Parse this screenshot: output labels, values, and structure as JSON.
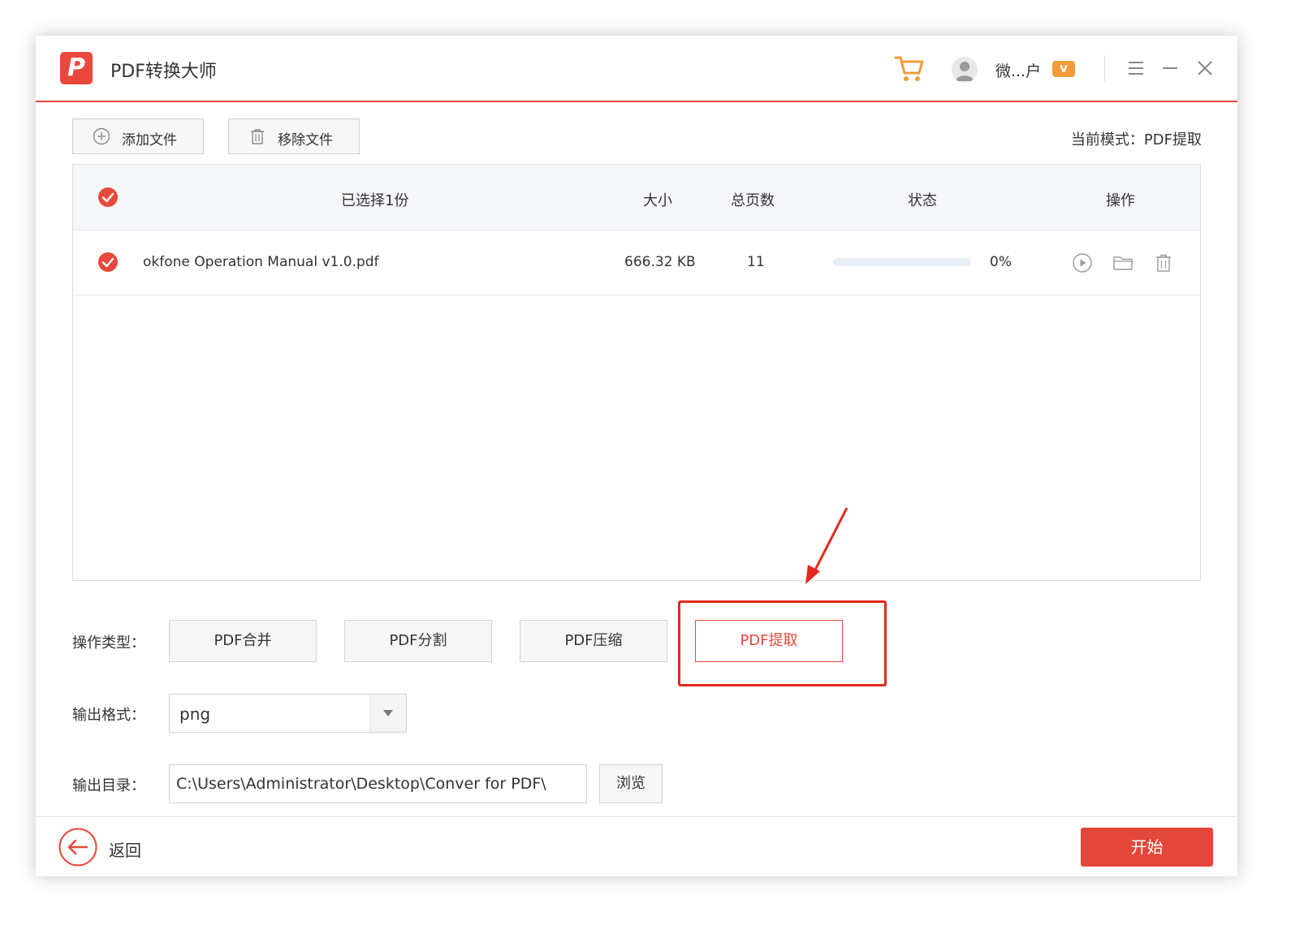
{
  "app": {
    "title": "PDF转换大师",
    "logo_letter": "P"
  },
  "titlebar": {
    "user_name": "微...户",
    "vip_badge": "V"
  },
  "toolbar": {
    "add_file": "添加文件",
    "remove_file": "移除文件",
    "current_mode": "当前模式：PDF提取"
  },
  "table": {
    "headers": {
      "selected": "已选择1份",
      "size": "大小",
      "pages": "总页数",
      "status": "状态",
      "actions": "操作"
    },
    "rows": [
      {
        "name": "okfone Operation Manual v1.0.pdf",
        "size": "666.32 KB",
        "pages": "11",
        "progress": 0,
        "percent": "0%"
      }
    ]
  },
  "operation": {
    "label": "操作类型：",
    "buttons": [
      "PDF合并",
      "PDF分割",
      "PDF压缩",
      "PDF提取"
    ],
    "active": "PDF提取"
  },
  "output_format": {
    "label": "输出格式：",
    "value": "png"
  },
  "output_dir": {
    "label": "输出目录：",
    "path": "C:\\Users\\Administrator\\Desktop\\Conver for PDF\\",
    "browse": "浏览"
  },
  "footer": {
    "back": "返回",
    "start": "开始"
  },
  "colors": {
    "accent": "#e8483b",
    "annotation": "#e5281f"
  }
}
